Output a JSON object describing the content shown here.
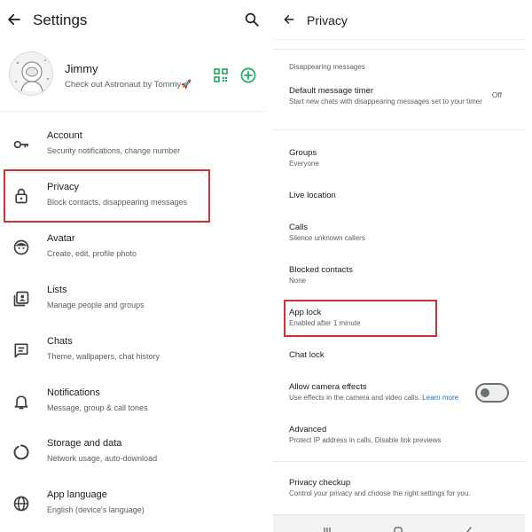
{
  "left": {
    "header": {
      "title": "Settings",
      "back_icon": "arrow-left-icon",
      "search_icon": "search-icon"
    },
    "profile": {
      "name": "Jimmy",
      "status": "Check out Astronaut by Tommy🚀",
      "qr_icon": "qr-code-icon",
      "add_icon": "add-contact-icon"
    },
    "items": [
      {
        "label": "Account",
        "sub": "Security notifications, change number",
        "icon": "key-icon"
      },
      {
        "label": "Privacy",
        "sub": "Block contacts, disappearing messages",
        "icon": "lock-icon"
      },
      {
        "label": "Avatar",
        "sub": "Create, edit, profile photo",
        "icon": "avatar-icon"
      },
      {
        "label": "Lists",
        "sub": "Manage people and groups",
        "icon": "lists-icon"
      },
      {
        "label": "Chats",
        "sub": "Theme, wallpapers, chat history",
        "icon": "chat-icon"
      },
      {
        "label": "Notifications",
        "sub": "Message, group & call tones",
        "icon": "bell-icon"
      },
      {
        "label": "Storage and data",
        "sub": "Network usage, auto-download",
        "icon": "storage-icon"
      },
      {
        "label": "App language",
        "sub": "English (device's language)",
        "icon": "globe-icon"
      }
    ]
  },
  "right": {
    "header": {
      "title": "Privacy",
      "back_icon": "arrow-left-icon"
    },
    "section_label": "Disappearing messages",
    "default_timer": {
      "label": "Default message timer",
      "sub": "Start new chats with disappearing messages set to your timer",
      "value": "Off"
    },
    "groups": {
      "label": "Groups",
      "sub": "Everyone"
    },
    "live_location": {
      "label": "Live location"
    },
    "calls": {
      "label": "Calls",
      "sub": "Silence unknown callers"
    },
    "blocked": {
      "label": "Blocked contacts",
      "sub": "None"
    },
    "app_lock": {
      "label": "App lock",
      "sub": "Enabled after 1 minute"
    },
    "chat_lock": {
      "label": "Chat lock"
    },
    "camera_effects": {
      "label": "Allow camera effects",
      "sub": "Use effects in the camera and video calls.",
      "link": "Learn more",
      "enabled": false
    },
    "advanced": {
      "label": "Advanced",
      "sub": "Protect IP address in calls, Disable link previews"
    },
    "checkup": {
      "label": "Privacy checkup",
      "sub": "Control your privacy and choose the right settings for you."
    }
  },
  "colors": {
    "highlight": "#c9343a",
    "accent_green": "#1daa61",
    "link_blue": "#1c6fc2"
  }
}
